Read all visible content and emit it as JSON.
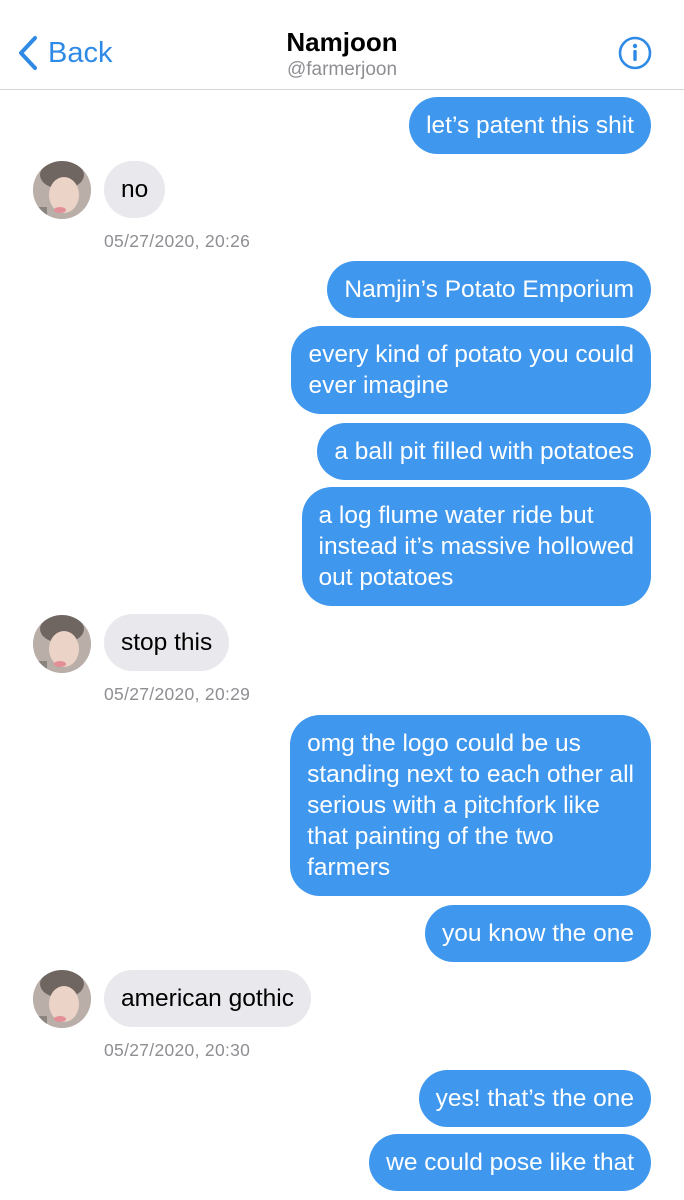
{
  "header": {
    "back_label": "Back",
    "title": "Namjoon",
    "handle": "@farmerjoon"
  },
  "messages": [
    {
      "direction": "outgoing",
      "text": "let’s patent this shit"
    },
    {
      "direction": "incoming",
      "text": "no"
    },
    {
      "direction": "outgoing",
      "text": "Namjin’s Potato Emporium"
    },
    {
      "direction": "outgoing",
      "text": "every kind of potato you could\never imagine"
    },
    {
      "direction": "outgoing",
      "text": "a ball pit filled with potatoes"
    },
    {
      "direction": "outgoing",
      "text": "a log flume water ride but\ninstead it’s massive hollowed\nout potatoes"
    },
    {
      "direction": "incoming",
      "text": "stop this"
    },
    {
      "direction": "outgoing",
      "text": "omg the logo could be us\nstanding next to each other all\nserious with a pitchfork like\nthat painting of the two\nfarmers"
    },
    {
      "direction": "outgoing",
      "text": "you know the one"
    },
    {
      "direction": "incoming",
      "text": "american gothic"
    },
    {
      "direction": "outgoing",
      "text": "yes! that’s the one"
    },
    {
      "direction": "outgoing",
      "text": "we could pose like that"
    }
  ],
  "timestamps": [
    "05/27/2020, 20:26",
    "05/27/2020, 20:29",
    "05/27/2020, 20:30"
  ],
  "colors": {
    "accent": "#2f8ae6",
    "outgoing_bubble": "#3f97ee",
    "incoming_bubble": "#e8e8ed",
    "timestamp": "#8e8e93"
  },
  "icons": {
    "back": "chevron-left-icon",
    "info": "info-circle-icon",
    "avatar": "contact-avatar"
  }
}
